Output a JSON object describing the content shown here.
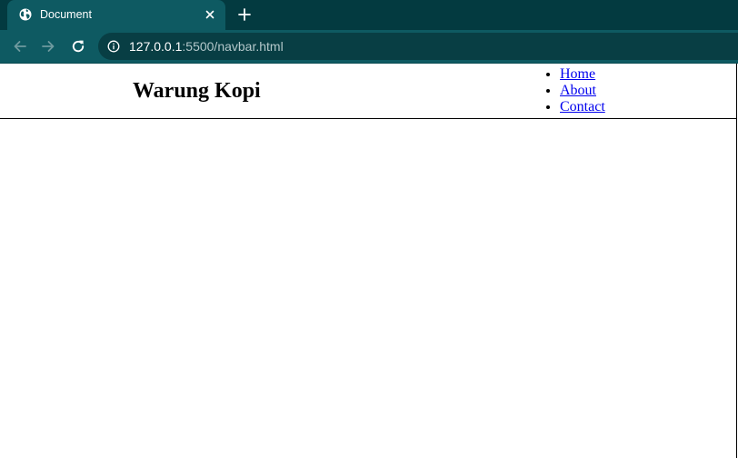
{
  "browser": {
    "tab": {
      "title": "Document"
    },
    "address_bar": {
      "host": "127.0.0.1",
      "rest": ":5500/navbar.html"
    },
    "colors": {
      "tabstrip": "#033a40",
      "toolbar": "#0e5a62",
      "omnibox": "#083e44"
    },
    "icons": [
      "globe-icon",
      "close-icon",
      "plus-icon",
      "back-arrow-icon",
      "forward-arrow-icon",
      "reload-icon",
      "info-icon"
    ]
  },
  "page": {
    "brand": "Warung Kopi",
    "nav_items": [
      {
        "label": "Home"
      },
      {
        "label": "About"
      },
      {
        "label": "Contact"
      }
    ],
    "link_color": "#0000ee"
  }
}
